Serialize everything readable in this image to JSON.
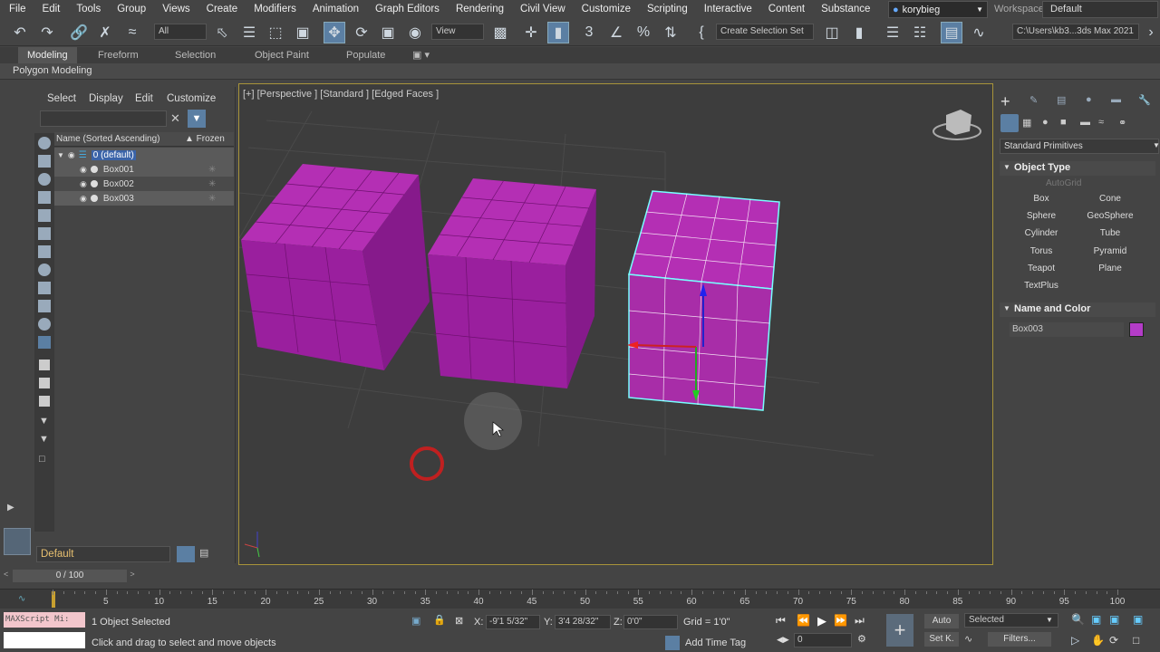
{
  "menu": [
    "File",
    "Edit",
    "Tools",
    "Group",
    "Views",
    "Create",
    "Modifiers",
    "Animation",
    "Graph Editors",
    "Rendering",
    "Civil View",
    "Customize",
    "Scripting",
    "Interactive",
    "Content",
    "Substance"
  ],
  "user": "korybieg",
  "workspaces_label": "Workspaces:",
  "workspace": "Default",
  "toolbar": {
    "filter": "All",
    "view": "View",
    "selection_set": "Create Selection Set",
    "path": "C:\\Users\\kb3...3ds Max 2021"
  },
  "ribbon": {
    "tabs": [
      "Modeling",
      "Freeform",
      "Selection",
      "Object Paint",
      "Populate"
    ],
    "sub": "Polygon Modeling"
  },
  "scene_explorer": {
    "tabs": [
      "Select",
      "Display",
      "Edit",
      "Customize"
    ],
    "col_name": "Name (Sorted Ascending)",
    "col_frozen": "▲ Frozen",
    "layer": "0 (default)",
    "objects": [
      "Box001",
      "Box002",
      "Box003"
    ],
    "layer_bottom": "Default"
  },
  "viewport": {
    "label": "[+] [Perspective ] [Standard ] [Edged Faces ]",
    "accent": "#a82da8"
  },
  "command_panel": {
    "dropdown": "Standard Primitives",
    "rollout_object_type": "Object Type",
    "autogrid": "AutoGrid",
    "buttons": [
      "Box",
      "Cone",
      "Sphere",
      "GeoSphere",
      "Cylinder",
      "Tube",
      "Torus",
      "Pyramid",
      "Teapot",
      "Plane",
      "TextPlus"
    ],
    "rollout_name_color": "Name and Color",
    "object_name": "Box003",
    "object_color": "#b43cc8"
  },
  "time_slider": "0 / 100",
  "timeline_ticks": [
    "5",
    "10",
    "15",
    "20",
    "25",
    "30",
    "35",
    "40",
    "45",
    "50",
    "55",
    "60",
    "65",
    "70",
    "75",
    "80",
    "85",
    "90",
    "95",
    "100"
  ],
  "status": {
    "maxscript": "MAXScript Mi:",
    "selected": "1 Object Selected",
    "prompt": "Click and drag to select and move objects",
    "x_label": "X:",
    "x": "-9'1 5/32\"",
    "y_label": "Y:",
    "y": "3'4 28/32\"",
    "z_label": "Z:",
    "z": "0'0\"",
    "grid": "Grid = 1'0\"",
    "add_time_tag": "Add Time Tag",
    "auto": "Auto",
    "selected_dropdown": "Selected",
    "frame": "0",
    "set_key": "Set K.",
    "filters": "Filters..."
  }
}
